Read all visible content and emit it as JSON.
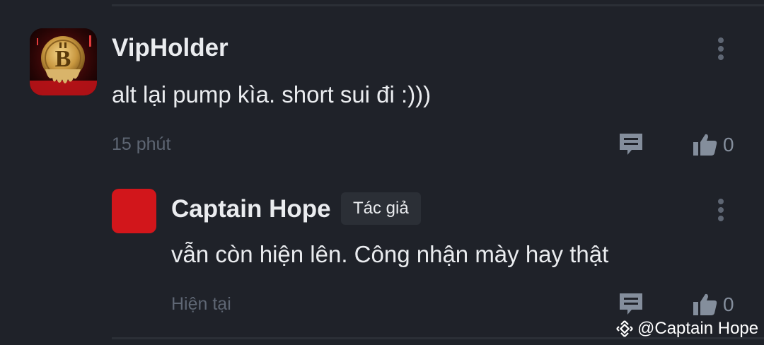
{
  "comments": {
    "main": {
      "username": "VipHolder",
      "text": "alt lại pump kìa. short sui đi :)))",
      "time": "15 phút",
      "likes": "0",
      "avatar_icon": "bitcoin-skull-avatar"
    },
    "reply": {
      "username": "Captain Hope",
      "badge": "Tác giả",
      "text": "vẫn còn hiện lên. Công nhận mày hay thật",
      "time": "Hiện tại",
      "likes": "0",
      "avatar_color": "#d2161b"
    }
  },
  "icons": {
    "more": "more-vertical-icon",
    "reply": "comment-icon",
    "like": "thumbs-up-icon"
  },
  "watermark": {
    "text": "@Captain Hope",
    "logo": "binance-logo"
  },
  "colors": {
    "background": "#1f2229",
    "text_primary": "#eaecef",
    "text_muted": "#5e6673",
    "icon": "#848e9c",
    "badge_bg": "#2b2f36"
  }
}
